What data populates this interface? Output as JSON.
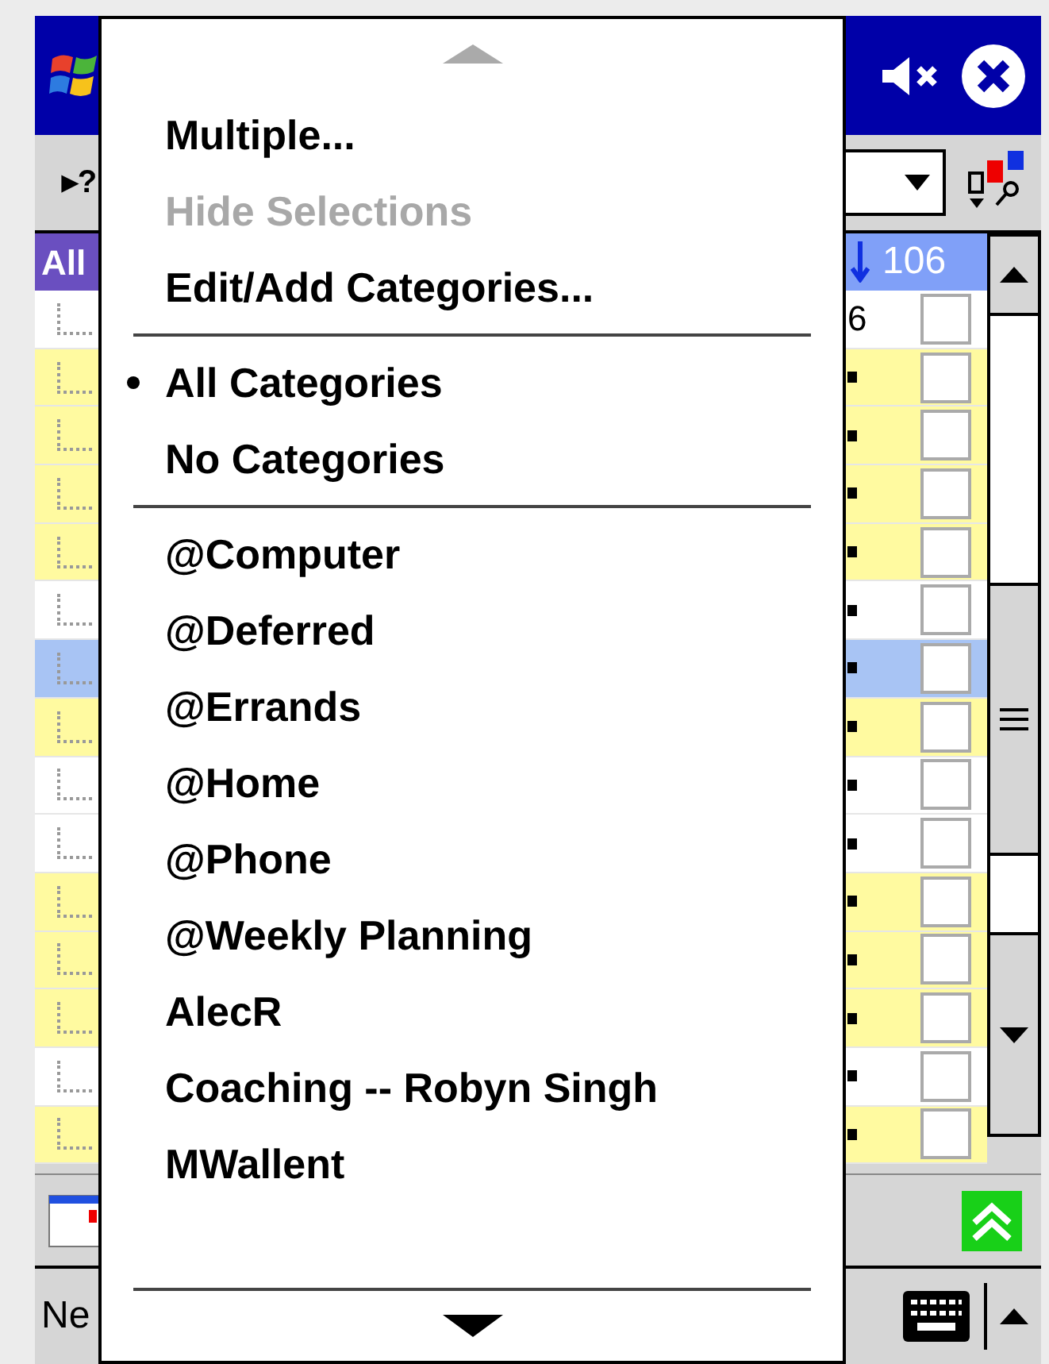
{
  "toolbar": {
    "help_button": "▸?"
  },
  "list_header": {
    "category": "All",
    "count": "106"
  },
  "rows": [
    {
      "highlighted": false,
      "selected": false,
      "checked": false,
      "column_3": "6"
    },
    {
      "highlighted": true,
      "selected": false,
      "checked": false
    },
    {
      "highlighted": true,
      "selected": false,
      "checked": false
    },
    {
      "highlighted": true,
      "selected": false,
      "checked": false
    },
    {
      "highlighted": true,
      "selected": false,
      "checked": false
    },
    {
      "highlighted": false,
      "selected": false,
      "checked": false
    },
    {
      "selected": true,
      "checked": false
    },
    {
      "highlighted": true,
      "selected": false,
      "checked": false
    },
    {
      "highlighted": false,
      "selected": false,
      "checked": false
    },
    {
      "highlighted": false,
      "selected": false,
      "checked": false
    },
    {
      "highlighted": true,
      "selected": false,
      "checked": false
    },
    {
      "highlighted": true,
      "selected": false,
      "checked": false
    },
    {
      "highlighted": true,
      "selected": false,
      "checked": false
    },
    {
      "highlighted": false,
      "selected": false,
      "checked": false
    },
    {
      "highlighted": true,
      "selected": false,
      "checked": false
    }
  ],
  "menu_bar": {
    "new_button": "Ne"
  },
  "menu": {
    "groups": [
      [
        {
          "label": "Multiple...",
          "disabled": false,
          "selected": false
        },
        {
          "label": "Hide Selections",
          "disabled": true,
          "selected": false
        },
        {
          "label": "Edit/Add Categories...",
          "disabled": false,
          "selected": false
        }
      ],
      [
        {
          "label": "All Categories",
          "disabled": false,
          "selected": true
        },
        {
          "label": "No Categories",
          "disabled": false,
          "selected": false
        }
      ],
      [
        {
          "label": "@Computer",
          "disabled": false,
          "selected": false
        },
        {
          "label": "@Deferred",
          "disabled": false,
          "selected": false
        },
        {
          "label": "@Errands",
          "disabled": false,
          "selected": false
        },
        {
          "label": "@Home",
          "disabled": false,
          "selected": false
        },
        {
          "label": "@Phone",
          "disabled": false,
          "selected": false
        },
        {
          "label": "@Weekly Planning",
          "disabled": false,
          "selected": false
        },
        {
          "label": "AlecR",
          "disabled": false,
          "selected": false
        },
        {
          "label": "Coaching -- Robyn Singh",
          "disabled": false,
          "selected": false
        },
        {
          "label": "MWallent",
          "disabled": false,
          "selected": false
        }
      ]
    ]
  }
}
